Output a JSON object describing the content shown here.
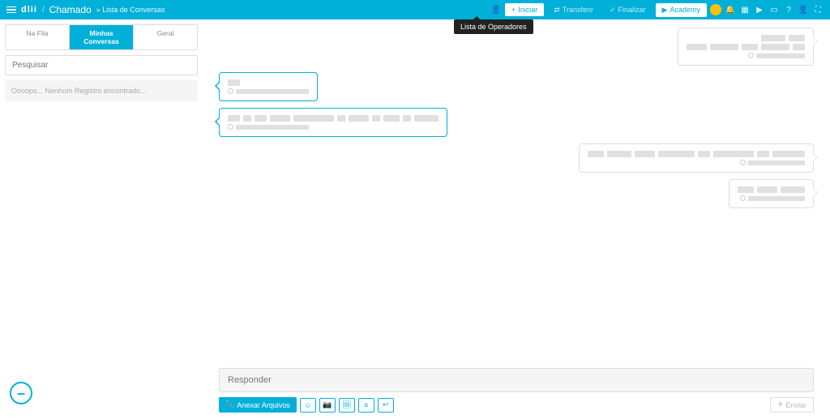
{
  "header": {
    "logo": "dlii",
    "breadcrumb_main": "Chamado",
    "breadcrumb_sub": "» Lista de Conversas",
    "btn_iniciar": "Iniciar",
    "btn_transferir": "Transferir",
    "btn_finalizar": "Finalizar",
    "btn_academy": "Academy",
    "tooltip": "Lista de Operadores"
  },
  "sidebar": {
    "tabs": [
      {
        "label": "Na Fila"
      },
      {
        "label": "Minhas Conversas"
      },
      {
        "label": "Geral"
      }
    ],
    "search_placeholder": "Pesquisar",
    "empty": "Oooops... Nenhum Registro encontrado..."
  },
  "compose": {
    "reply_placeholder": "Responder",
    "attach_label": "Anexar Arquivos",
    "send_label": "Enviar"
  },
  "fab": "–"
}
